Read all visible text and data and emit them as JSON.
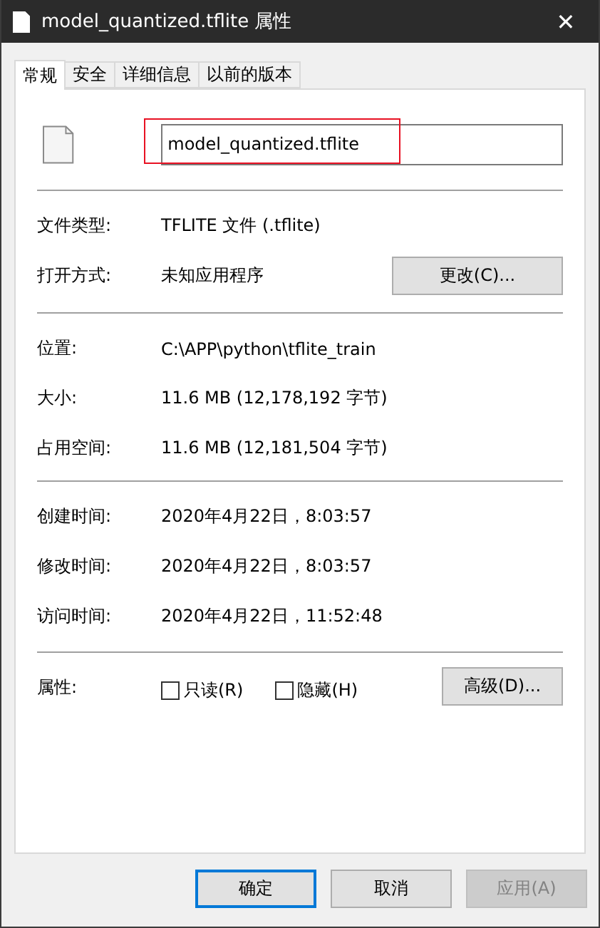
{
  "window": {
    "title": "model_quantized.tflite 属性",
    "close": "✕"
  },
  "tabs": [
    {
      "label": "常规",
      "selected": true
    },
    {
      "label": "安全",
      "selected": false
    },
    {
      "label": "详细信息",
      "selected": false
    },
    {
      "label": "以前的版本",
      "selected": false
    }
  ],
  "file_name": {
    "value": "model_quantized.tflite",
    "highlighted": true
  },
  "groups": [
    [
      {
        "label": "文件类型:",
        "value": "TFLITE 文件 (.tflite)"
      },
      {
        "label": "打开方式:",
        "value": "未知应用程序",
        "button": "更改(C)..."
      }
    ],
    [
      {
        "label": "位置:",
        "value": "C:\\APP\\python\\tflite_train"
      },
      {
        "label": "大小:",
        "value": "11.6 MB (12,178,192 字节)"
      },
      {
        "label": "占用空间:",
        "value": "11.6 MB (12,181,504 字节)"
      }
    ],
    [
      {
        "label": "创建时间:",
        "value": "2020年4月22日，8:03:57"
      },
      {
        "label": "修改时间:",
        "value": "2020年4月22日，8:03:57"
      },
      {
        "label": "访问时间:",
        "value": "2020年4月22日，11:52:48"
      }
    ]
  ],
  "attributes": {
    "label": "属性:",
    "checkboxes": [
      {
        "label": "只读(R)",
        "checked": false
      },
      {
        "label": "隐藏(H)",
        "checked": false
      }
    ],
    "button": "高级(D)..."
  },
  "buttons": [
    {
      "label": "确定",
      "kind": "default",
      "disabled": false
    },
    {
      "label": "取消",
      "kind": "normal",
      "disabled": false
    },
    {
      "label": "应用(A)",
      "kind": "normal",
      "disabled": true
    }
  ]
}
